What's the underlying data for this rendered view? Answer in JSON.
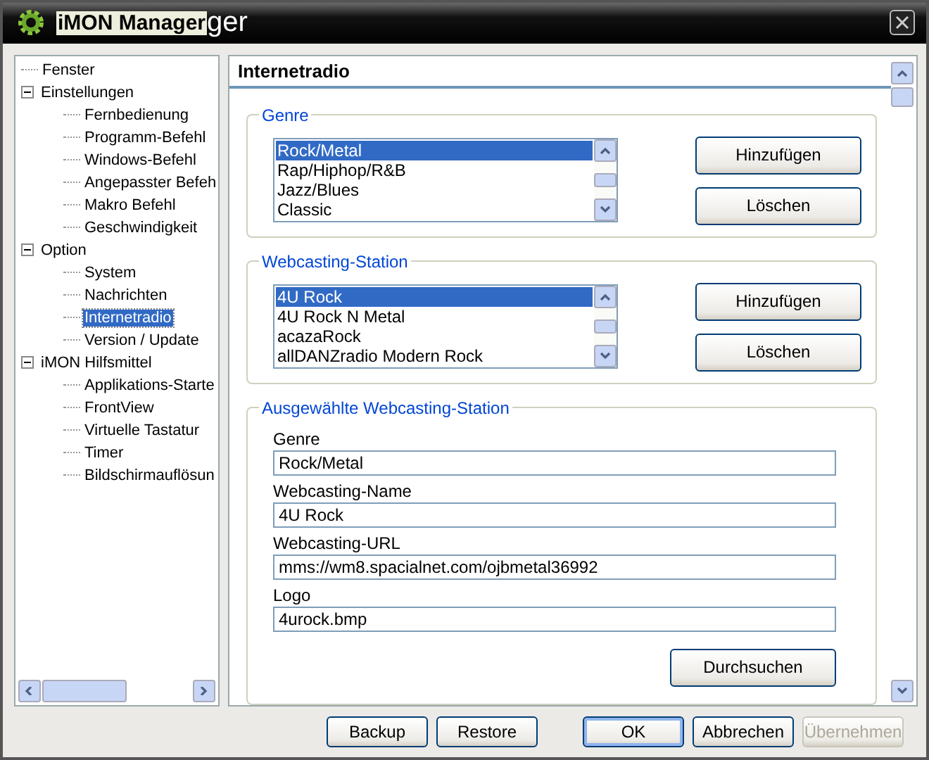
{
  "window": {
    "title": "iMON Manager",
    "title_echo": "ger"
  },
  "tree": [
    {
      "label": "Fenster",
      "selected": false
    },
    {
      "label": "Einstellungen",
      "selected": false,
      "expanded": true,
      "children": [
        {
          "label": "Fernbedienung",
          "selected": false
        },
        {
          "label": "Programm-Befehl",
          "selected": false
        },
        {
          "label": "Windows-Befehl",
          "selected": false
        },
        {
          "label": "Angepasster Befeh",
          "selected": false
        },
        {
          "label": "Makro  Befehl",
          "selected": false
        },
        {
          "label": "Geschwindigkeit",
          "selected": false
        }
      ]
    },
    {
      "label": "Option",
      "selected": false,
      "expanded": true,
      "children": [
        {
          "label": "System",
          "selected": false
        },
        {
          "label": "Nachrichten",
          "selected": false
        },
        {
          "label": "Internetradio",
          "selected": true
        },
        {
          "label": "Version / Update",
          "selected": false
        }
      ]
    },
    {
      "label": "iMON Hilfsmittel",
      "selected": false,
      "expanded": true,
      "children": [
        {
          "label": "Applikations-Starte",
          "selected": false
        },
        {
          "label": "FrontView",
          "selected": false
        },
        {
          "label": "Virtuelle Tastatur",
          "selected": false
        },
        {
          "label": "Timer",
          "selected": false
        },
        {
          "label": "Bildschirmauflösun",
          "selected": false
        }
      ]
    }
  ],
  "panel": {
    "title": "Internetradio",
    "lists": [
      {
        "title": "Genre",
        "items": [
          {
            "label": "Rock/Metal",
            "selected": true
          },
          {
            "label": "Rap/Hiphop/R&B",
            "selected": false
          },
          {
            "label": "Jazz/Blues",
            "selected": false
          },
          {
            "label": "Classic",
            "selected": false
          }
        ],
        "buttons": [
          "Hinzufügen",
          "Löschen"
        ]
      },
      {
        "title": "Webcasting-Station",
        "items": [
          {
            "label": "4U Rock",
            "selected": true
          },
          {
            "label": "4U Rock N Metal",
            "selected": false
          },
          {
            "label": "acazaRock",
            "selected": false
          },
          {
            "label": "allDANZradio Modern Rock",
            "selected": false
          }
        ],
        "buttons": [
          "Hinzufügen",
          "Löschen"
        ]
      }
    ],
    "details": {
      "title": "Ausgewählte Webcasting-Station",
      "fields": [
        {
          "label": "Genre",
          "value": "Rock/Metal"
        },
        {
          "label": "Webcasting-Name",
          "value": "4U Rock"
        },
        {
          "label": "Webcasting-URL",
          "value": "mms://wm8.spacialnet.com/ojbmetal36992"
        },
        {
          "label": "Logo",
          "value": "4urock.bmp"
        }
      ],
      "button": "Durchsuchen"
    }
  },
  "footer": {
    "left": [
      {
        "label": "Backup",
        "disabled": false,
        "focused": false
      },
      {
        "label": "Restore",
        "disabled": false,
        "focused": false
      }
    ],
    "right": [
      {
        "label": "OK",
        "disabled": false,
        "focused": true
      },
      {
        "label": "Abbrechen",
        "disabled": false,
        "focused": false
      },
      {
        "label": "Übernehmen",
        "disabled": true,
        "focused": false
      }
    ]
  }
}
